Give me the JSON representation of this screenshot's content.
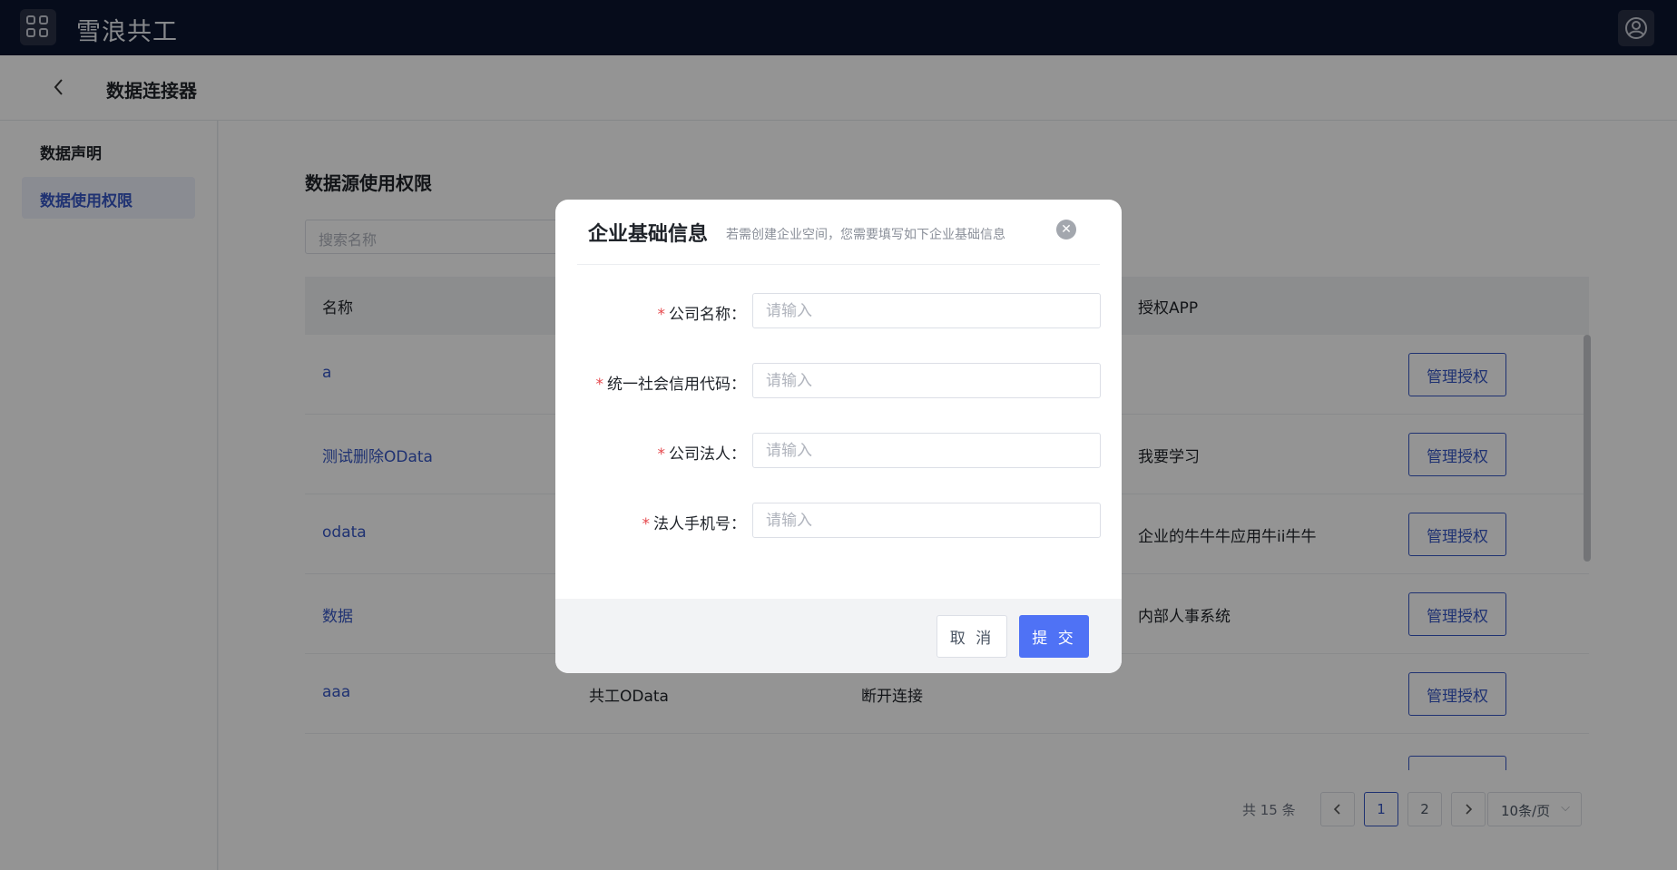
{
  "header": {
    "brand": "雪浪共工"
  },
  "subheader": {
    "title": "数据连接器"
  },
  "sidebar": {
    "items": [
      {
        "label": "数据声明",
        "active": false
      },
      {
        "label": "数据使用权限",
        "active": true
      }
    ]
  },
  "main": {
    "section_title": "数据源使用权限",
    "search_placeholder": "搜索名称",
    "columns": [
      "名称",
      "授权APP"
    ],
    "rows": [
      {
        "name": "a",
        "type": "",
        "status": "",
        "app": "",
        "action": "管理授权"
      },
      {
        "name": "测试删除OData",
        "type": "",
        "status": "",
        "app": "我要学习",
        "action": "管理授权"
      },
      {
        "name": "odata",
        "type": "",
        "status": "",
        "app": "企业的牛牛牛应用牛ii牛牛",
        "action": "管理授权"
      },
      {
        "name": "数据",
        "type": "",
        "status": "",
        "app": "内部人事系统",
        "action": "管理授权"
      },
      {
        "name": "aaa",
        "type": "共工OData",
        "status": "断开连接",
        "app": "",
        "action": "管理授权"
      }
    ],
    "pagination": {
      "total": "共 15 条",
      "pages": [
        "1",
        "2"
      ],
      "current": "1",
      "page_size": "10条/页"
    }
  },
  "modal": {
    "title": "企业基础信息",
    "subtitle": "若需创建企业空间，您需要填写如下企业基础信息",
    "fields": [
      {
        "label": "公司名称：",
        "placeholder": "请输入"
      },
      {
        "label": "统一社会信用代码：",
        "placeholder": "请输入"
      },
      {
        "label": "公司法人：",
        "placeholder": "请输入"
      },
      {
        "label": "法人手机号：",
        "placeholder": "请输入"
      }
    ],
    "required_mark": "*",
    "cancel_label": "取 消",
    "submit_label": "提 交"
  },
  "colors": {
    "topbar": "#0c1530",
    "accent": "#3656c4",
    "submit": "#4f72f5",
    "required": "#e5484d"
  },
  "icons": {
    "app_menu": "grid-icon",
    "user": "user-avatar-icon",
    "back": "chevron-left-icon",
    "close": "close-circle-icon",
    "prev": "chevron-left-icon",
    "next": "chevron-right-icon",
    "dropdown": "chevron-down-icon"
  }
}
